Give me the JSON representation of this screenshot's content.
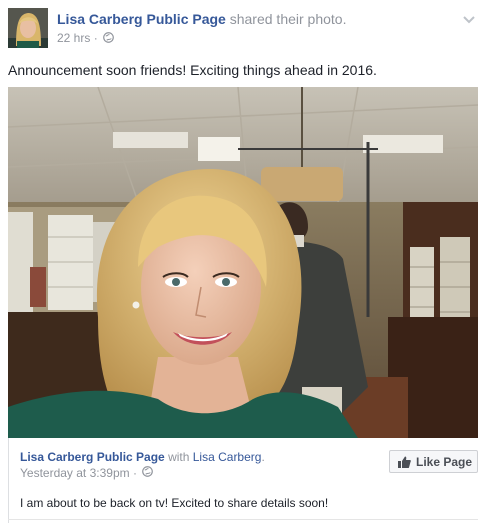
{
  "post": {
    "page_name": "Lisa Carberg Public Page",
    "action": "shared their photo.",
    "time": "22 hrs",
    "separator": "·",
    "status_text": "Announcement soon friends! Exciting things ahead in 2016."
  },
  "shared": {
    "page_name": "Lisa Carberg Public Page",
    "with_word": "with",
    "tagged_name": "Lisa Carberg",
    "tagged_suffix": ".",
    "time": "Yesterday at 3:39pm",
    "separator": "·",
    "caption": "I am about to be back on tv! Excited to share details soon!",
    "like_label": "Like Page"
  },
  "icons": {
    "privacy": "globe-icon",
    "options": "chevron-down-icon",
    "like": "thumbs-up-icon"
  },
  "colors": {
    "link": "#365899",
    "meta": "#90949c",
    "text": "#1d2129",
    "button_bg": "#f6f7f9"
  }
}
